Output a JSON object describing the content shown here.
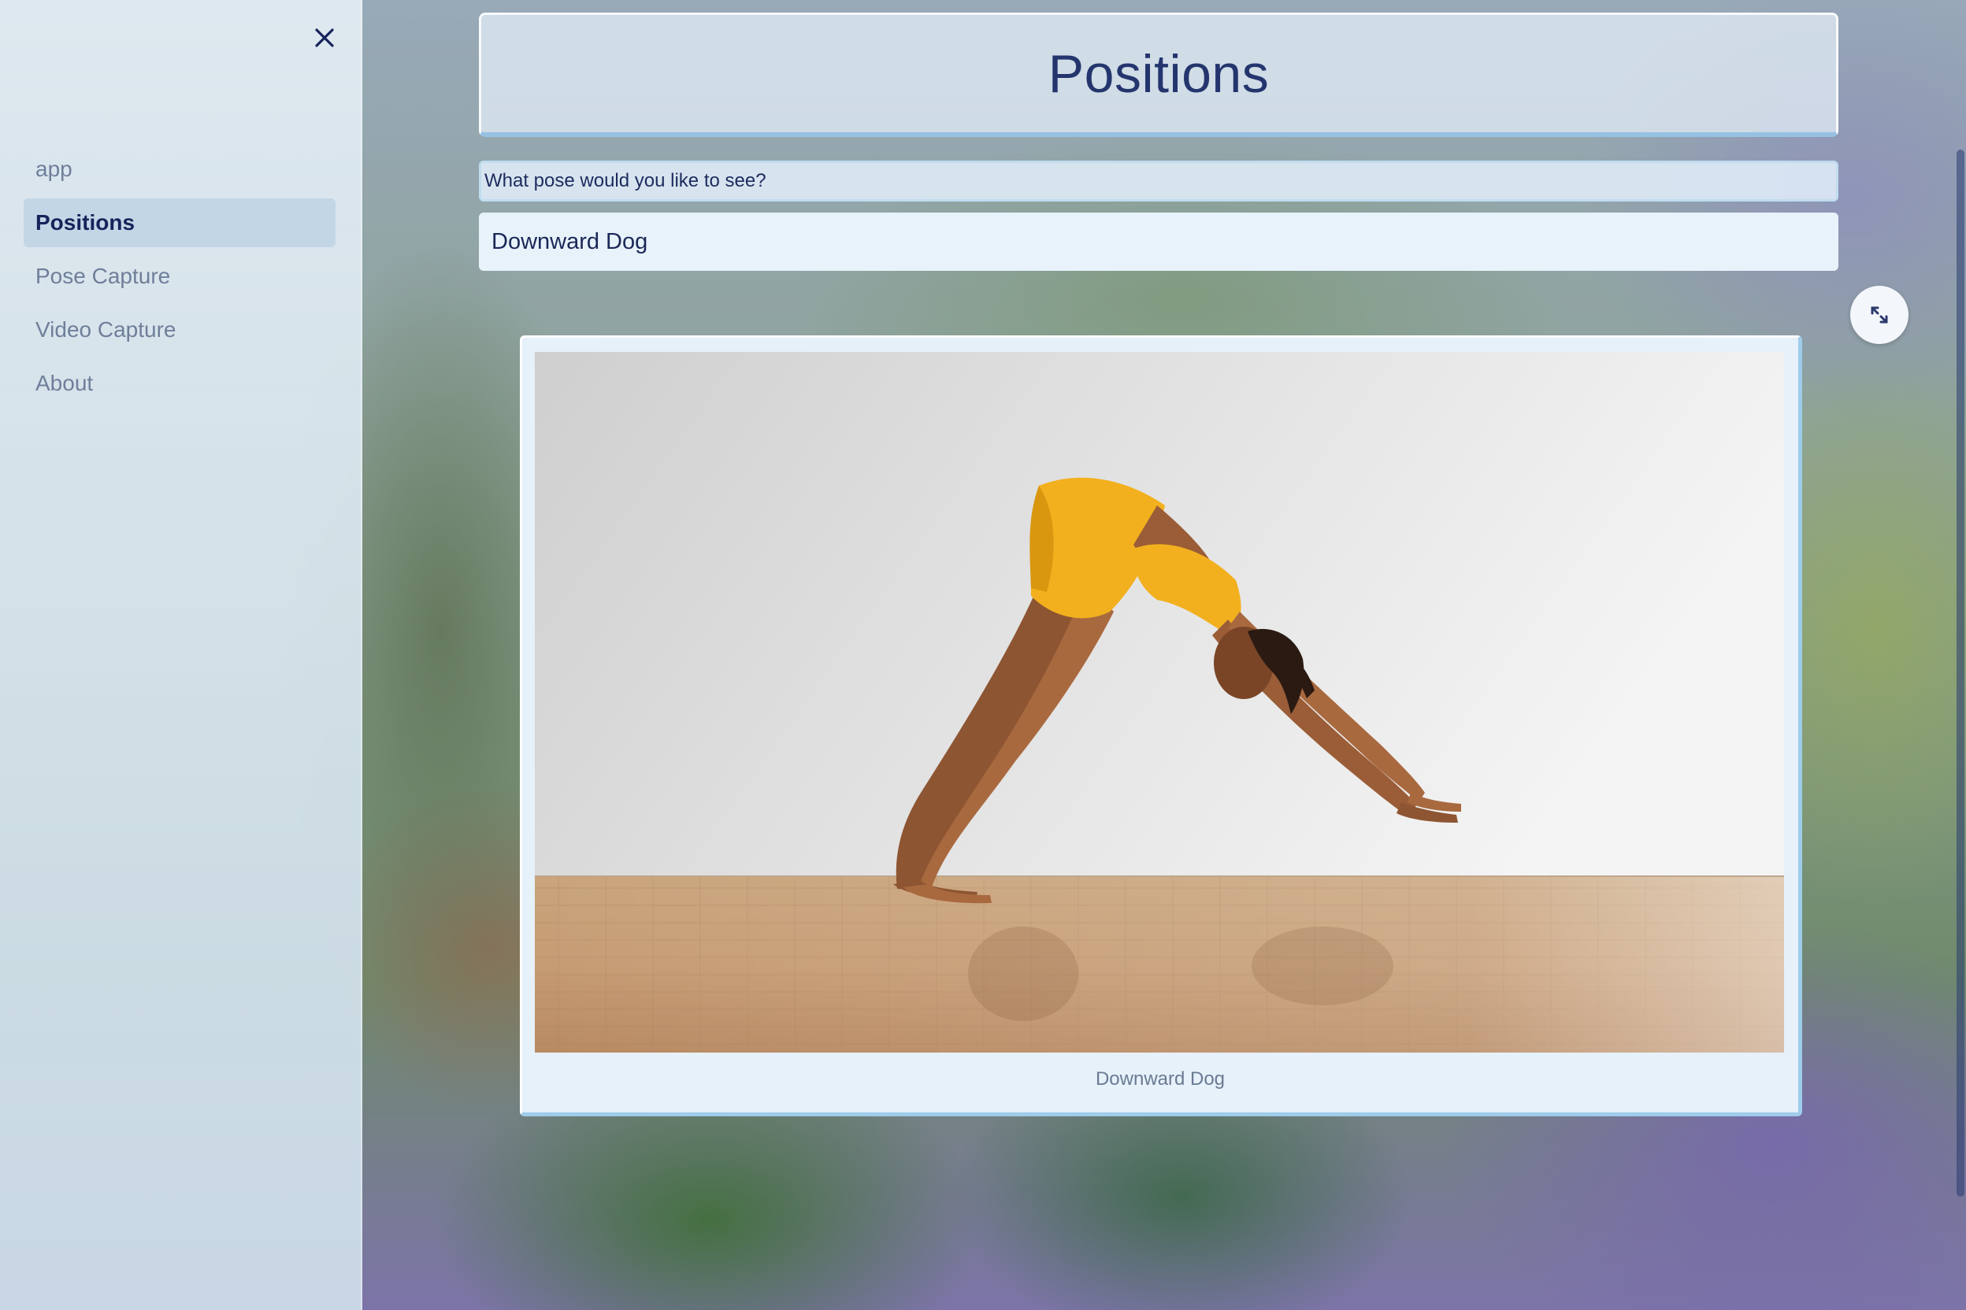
{
  "sidebar": {
    "close_icon": "close-icon",
    "items": [
      {
        "label": "app",
        "active": false
      },
      {
        "label": "Positions",
        "active": true
      },
      {
        "label": "Pose Capture",
        "active": false
      },
      {
        "label": "Video Capture",
        "active": false
      },
      {
        "label": "About",
        "active": false
      }
    ]
  },
  "main": {
    "title": "Positions",
    "select_label": "What pose would you like to see?",
    "selected_pose": "Downward Dog",
    "image_caption": "Downward Dog",
    "fullscreen_icon": "fullscreen-icon"
  },
  "colors": {
    "accent": "#16235a",
    "sidebar_bg": "#dbe7f0",
    "card_bg": "#e6f1fa",
    "outfit": "#f2b01e"
  }
}
